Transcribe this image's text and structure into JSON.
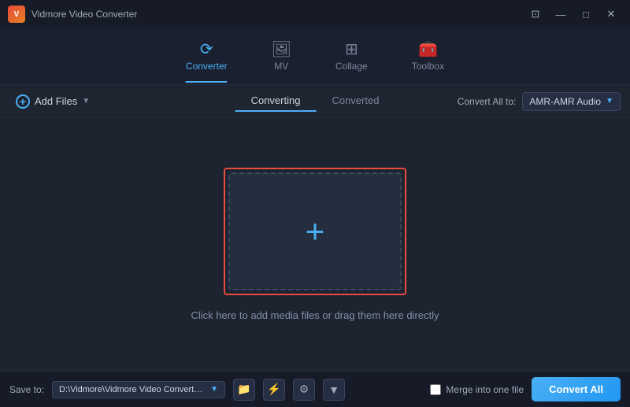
{
  "titleBar": {
    "appName": "Vidmore Video Converter",
    "controls": {
      "minimize": "—",
      "maximize": "□",
      "close": "✕",
      "chat": "⊡"
    }
  },
  "nav": {
    "tabs": [
      {
        "id": "converter",
        "label": "Converter",
        "active": true
      },
      {
        "id": "mv",
        "label": "MV",
        "active": false
      },
      {
        "id": "collage",
        "label": "Collage",
        "active": false
      },
      {
        "id": "toolbox",
        "label": "Toolbox",
        "active": false
      }
    ]
  },
  "toolbar": {
    "addFiles": "Add Files",
    "subTabs": [
      {
        "id": "converting",
        "label": "Converting",
        "active": true
      },
      {
        "id": "converted",
        "label": "Converted",
        "active": false
      }
    ],
    "convertAllTo": "Convert All to:",
    "formatValue": "AMR-AMR Audio"
  },
  "mainContent": {
    "dropHint": "Click here to add media files or drag them here directly",
    "plusIcon": "+"
  },
  "bottomBar": {
    "saveToLabel": "Save to:",
    "savePath": "D:\\Vidmore\\Vidmore Video Converter\\Converted",
    "mergeLabel": "Merge into one file",
    "convertAllBtn": "Convert All"
  }
}
